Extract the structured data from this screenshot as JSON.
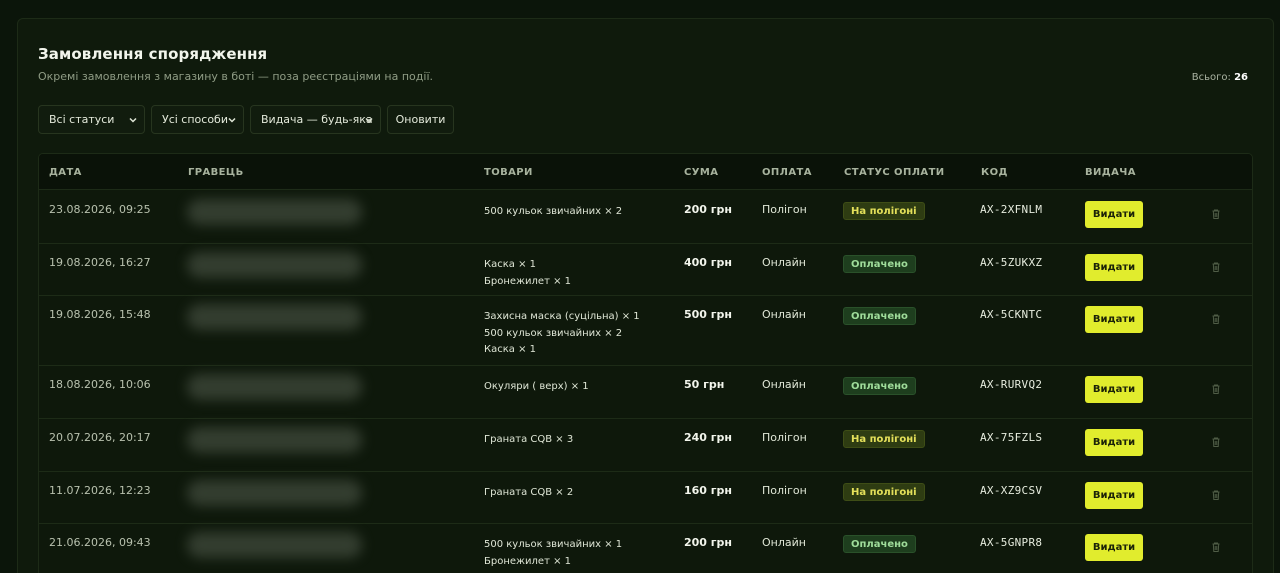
{
  "header": {
    "title": "Замовлення спорядження",
    "subtitle": "Окремі замовлення з магазину в боті — поза реєстраціями на події.",
    "total_label": "Всього:",
    "total_value": "26"
  },
  "filters": {
    "status": "Всі статуси",
    "method": "Усі способи",
    "issue": "Видача — будь-яка",
    "refresh": "Оновити"
  },
  "columns": [
    "ДАТА",
    "ГРАВЕЦЬ",
    "ТОВАРИ",
    "СУМА",
    "ОПЛАТА",
    "СТАТУС ОПЛАТИ",
    "КОД",
    "ВИДАЧА"
  ],
  "colors": {
    "accent": "#e1ec2d",
    "paid": "#9fdc9a",
    "polygon": "#e4e05a"
  },
  "rows": [
    {
      "date": "23.08.2026, 09:25",
      "items": [
        "500 кульок звичайних × 2"
      ],
      "sum": "200 грн",
      "payment": "Полігон",
      "status": "На полігоні",
      "status_kind": "polygon",
      "code": "AX-2XFNLM",
      "action": "Видати"
    },
    {
      "date": "19.08.2026, 16:27",
      "items": [
        "Каска × 1",
        "Бронежилет × 1"
      ],
      "sum": "400 грн",
      "payment": "Онлайн",
      "status": "Оплачено",
      "status_kind": "paid",
      "code": "AX-5ZUKXZ",
      "action": "Видати"
    },
    {
      "date": "19.08.2026, 15:48",
      "items": [
        "Захисна маска (суцільна) × 1",
        "500 кульок звичайних × 2",
        "Каска × 1"
      ],
      "sum": "500 грн",
      "payment": "Онлайн",
      "status": "Оплачено",
      "status_kind": "paid",
      "code": "AX-5CKNTC",
      "action": "Видати"
    },
    {
      "date": "18.08.2026, 10:06",
      "items": [
        "Окуляри ( верх) × 1"
      ],
      "sum": "50 грн",
      "payment": "Онлайн",
      "status": "Оплачено",
      "status_kind": "paid",
      "code": "AX-RURVQ2",
      "action": "Видати"
    },
    {
      "date": "20.07.2026, 20:17",
      "items": [
        "Граната CQB × 3"
      ],
      "sum": "240 грн",
      "payment": "Полігон",
      "status": "На полігоні",
      "status_kind": "polygon",
      "code": "AX-75FZLS",
      "action": "Видати"
    },
    {
      "date": "11.07.2026, 12:23",
      "items": [
        "Граната CQB × 2"
      ],
      "sum": "160 грн",
      "payment": "Полігон",
      "status": "На полігоні",
      "status_kind": "polygon",
      "code": "AX-XZ9CSV",
      "action": "Видати"
    },
    {
      "date": "21.06.2026, 09:43",
      "items": [
        "500 кульок звичайних × 1",
        "Бронежилет × 1"
      ],
      "sum": "200 грн",
      "payment": "Онлайн",
      "status": "Оплачено",
      "status_kind": "paid",
      "code": "AX-5GNPR8",
      "action": "Видати"
    }
  ]
}
